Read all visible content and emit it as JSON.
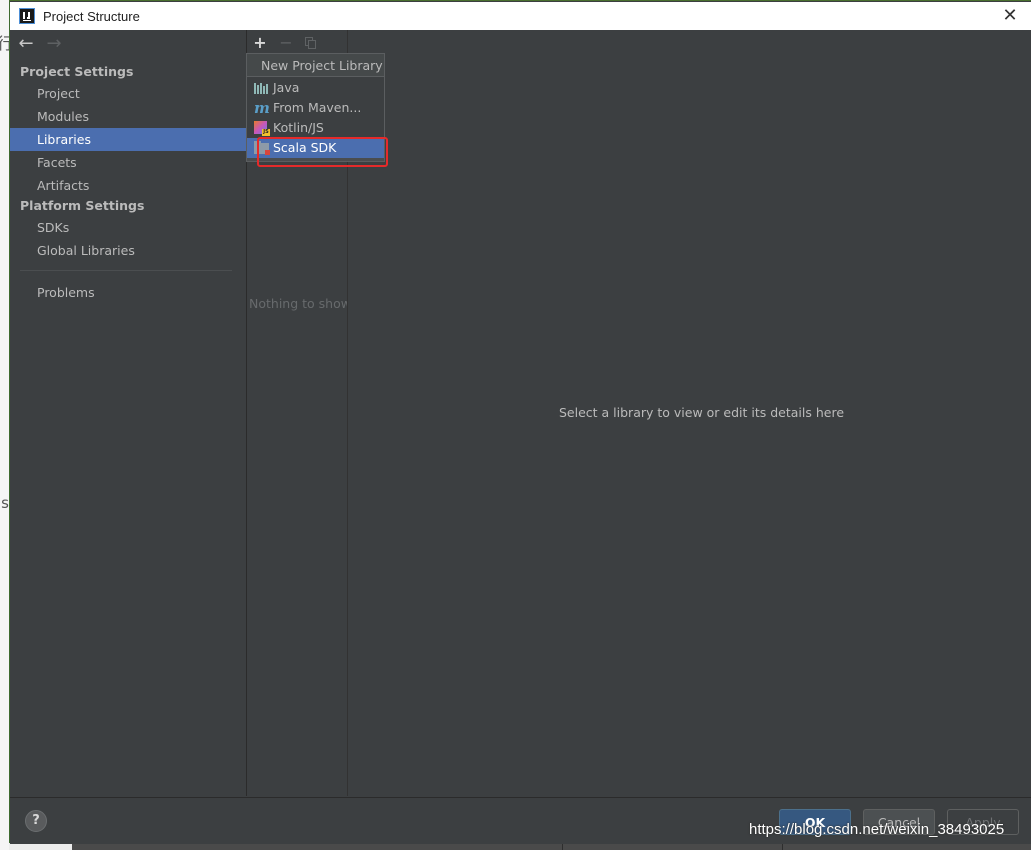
{
  "window": {
    "title": "Project Structure"
  },
  "background": {
    "left_glyphs": [
      "行",
      "ls"
    ]
  },
  "sidebar": {
    "sections": [
      {
        "header": "Project Settings",
        "items": [
          "Project",
          "Modules",
          "Libraries",
          "Facets",
          "Artifacts"
        ]
      },
      {
        "header": "Platform Settings",
        "items": [
          "SDKs",
          "Global Libraries"
        ]
      }
    ],
    "problems": "Problems",
    "selected": "Libraries"
  },
  "libraries_panel": {
    "empty_text": "Nothing to show"
  },
  "popup": {
    "title": "New Project Library",
    "items": [
      {
        "label": "Java",
        "icon": "java-library-icon"
      },
      {
        "label": "From Maven...",
        "icon": "maven-icon"
      },
      {
        "label": "Kotlin/JS",
        "icon": "kotlin-js-icon"
      },
      {
        "label": "Scala SDK",
        "icon": "scala-sdk-folder-icon"
      }
    ],
    "highlighted": "Scala SDK"
  },
  "details": {
    "placeholder": "Select a library to view or edit its details here"
  },
  "footer": {
    "help": "?",
    "ok": "OK",
    "cancel": "Cancel",
    "apply": "Apply"
  },
  "watermark": "https://blog.csdn.net/weixin_38493025",
  "colors": {
    "selection": "#4b6eaf",
    "panel_bg": "#3c3f41",
    "annotation": "#e52a2a"
  }
}
